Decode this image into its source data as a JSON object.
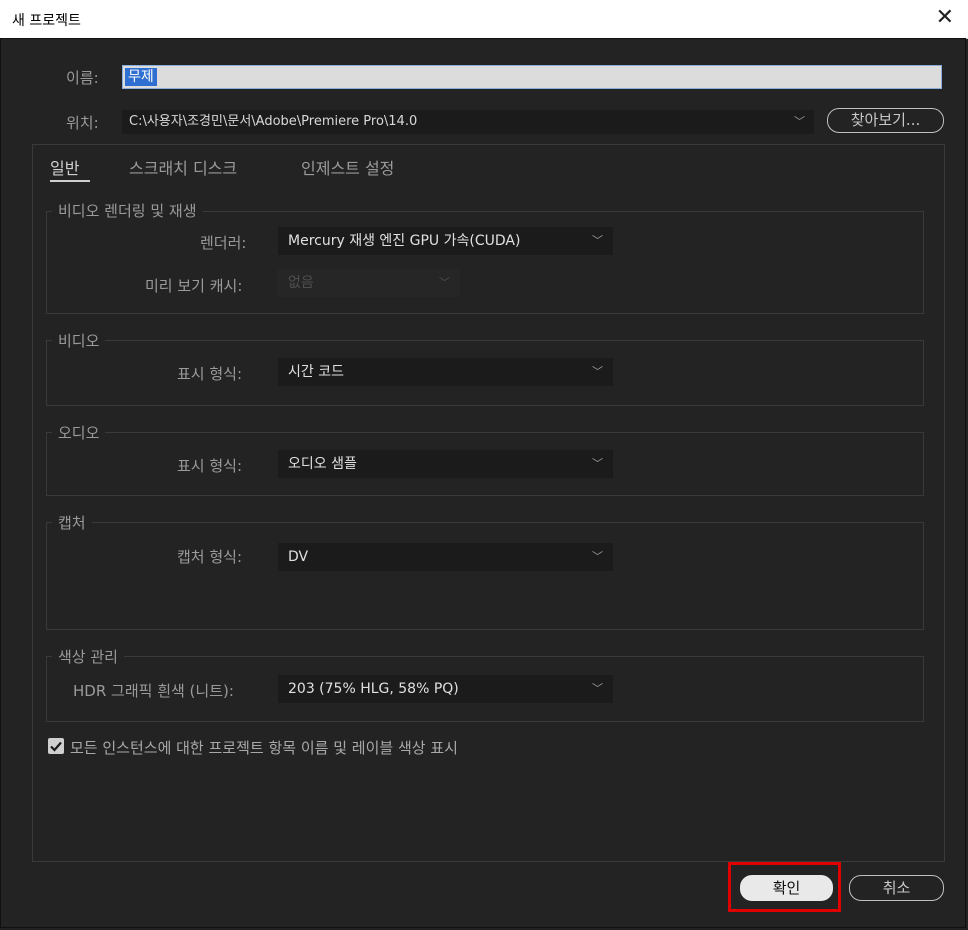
{
  "window": {
    "title": "새 프로젝트",
    "close_symbol": "✕"
  },
  "name": {
    "label": "이름:",
    "value": "무제"
  },
  "location": {
    "label": "위치:",
    "value": "C:\\사용자\\조경민\\문서\\Adobe\\Premiere Pro\\14.0",
    "browse_label": "찾아보기..."
  },
  "tabs": [
    "일반",
    "스크래치 디스크",
    "인제스트 설정"
  ],
  "groups": {
    "video_render": {
      "title": "비디오 렌더링 및 재생",
      "renderer_label": "렌더러:",
      "renderer_value": "Mercury 재생 엔진 GPU 가속(CUDA)",
      "preview_cache_label": "미리 보기 캐시:",
      "preview_cache_value": "없음"
    },
    "video": {
      "title": "비디오",
      "display_format_label": "표시 형식:",
      "display_format_value": "시간 코드"
    },
    "audio": {
      "title": "오디오",
      "display_format_label": "표시 형식:",
      "display_format_value": "오디오 샘플"
    },
    "capture": {
      "title": "캡처",
      "capture_format_label": "캡처 형식:",
      "capture_format_value": "DV"
    },
    "color": {
      "title": "색상 관리",
      "hdr_label": "HDR 그래픽 흰색 (니트):",
      "hdr_value": "203 (75% HLG, 58% PQ)"
    }
  },
  "checkbox": {
    "label": "모든 인스턴스에 대한 프로젝트 항목 이름 및 레이블 색상 표시",
    "checked": true
  },
  "buttons": {
    "ok": "확인",
    "cancel": "취소"
  },
  "icons": {
    "chevron": "chevron-down-icon",
    "check": "checkmark-icon",
    "close": "close-icon"
  }
}
